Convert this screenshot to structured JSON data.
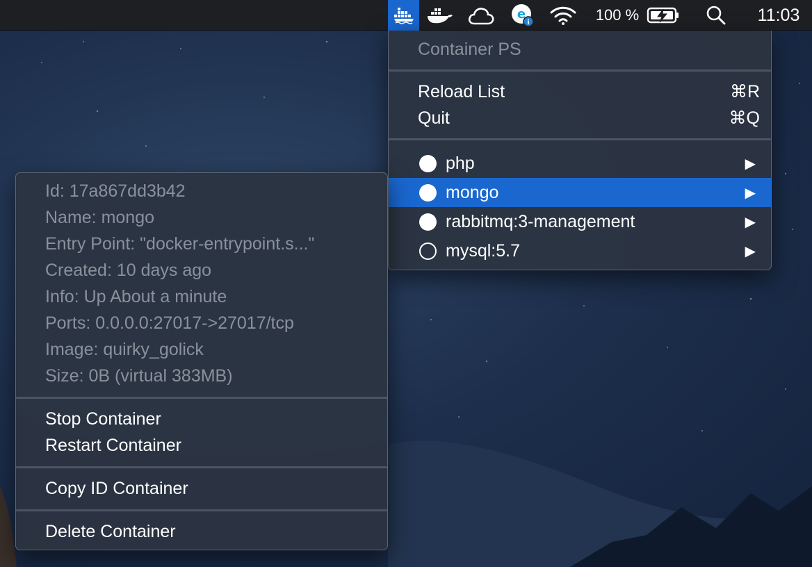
{
  "menubar": {
    "icons": [
      "docker-whale-icon",
      "docker-whale-icon",
      "cloud-icon",
      "evernote-helper-icon",
      "wifi-icon",
      "battery-charging-icon",
      "search-icon"
    ],
    "battery_percent": "100 %",
    "clock": "11:03"
  },
  "main_menu": {
    "title": "Container PS",
    "actions": [
      {
        "label": "Reload List",
        "shortcut": "⌘R"
      },
      {
        "label": "Quit",
        "shortcut": "⌘Q"
      }
    ],
    "containers": [
      {
        "name": "php",
        "status": "running"
      },
      {
        "name": "mongo",
        "status": "running",
        "highlighted": true
      },
      {
        "name": "rabbitmq:3-management",
        "status": "running"
      },
      {
        "name": "mysql:5.7",
        "status": "stopped"
      }
    ],
    "submenu_arrow": "▶"
  },
  "sub_menu": {
    "info": [
      "Id: 17a867dd3b42",
      "Name: mongo",
      "Entry Point: \"docker-entrypoint.s...\"",
      "Created: 10 days ago",
      "Info: Up About a minute",
      "Ports: 0.0.0.0:27017->27017/tcp",
      "Image: quirky_golick",
      "Size: 0B (virtual 383MB)"
    ],
    "actions": {
      "stop": "Stop Container",
      "restart": "Restart Container",
      "copy_id": "Copy ID Container",
      "delete": "Delete Container"
    }
  },
  "colors": {
    "accent": "#1a67cf",
    "menu_bg": "#2c3442",
    "disabled_text": "#8a919c"
  }
}
